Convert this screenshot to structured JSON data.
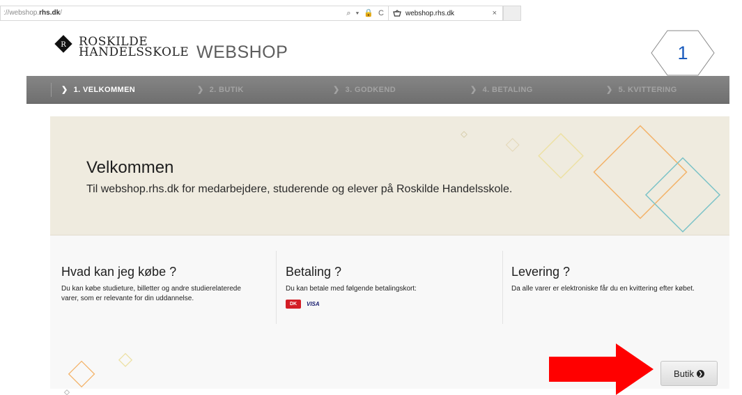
{
  "browser": {
    "url_prefix": "://webshop.",
    "url_domain": "rhs.dk",
    "url_suffix": "/",
    "tab_title": "webshop.rhs.dk",
    "tab_close": "×",
    "address_icons": "⌕ ▾ 🔒 C"
  },
  "header": {
    "logo_line1": "ROSKILDE",
    "logo_line2": "HANDELSSKOLE",
    "webshop": "WEBSHOP",
    "step_number": "1"
  },
  "steps": [
    {
      "label": "1.  VELKOMMEN",
      "active": true
    },
    {
      "label": "2.  BUTIK",
      "active": false
    },
    {
      "label": "3.  GODKEND",
      "active": false
    },
    {
      "label": "4.  BETALING",
      "active": false
    },
    {
      "label": "5.  KVITTERING",
      "active": false
    }
  ],
  "hero": {
    "title": "Velkommen",
    "text": "Til webshop.rhs.dk for medarbejdere, studerende og elever på Roskilde Handelsskole."
  },
  "columns": {
    "buy": {
      "title": "Hvad kan jeg købe ?",
      "text": "Du kan købe studieture, billetter og andre studierelaterede varer, som er relevante for din uddannelse."
    },
    "payment": {
      "title": "Betaling ?",
      "text": "Du kan betale med følgende betalingskort:",
      "card1": "DK",
      "card2": "VISA"
    },
    "delivery": {
      "title": "Levering ?",
      "text": "Da alle varer er elektroniske får du en kvittering efter købet."
    }
  },
  "actions": {
    "butik_label": "Butik",
    "butik_icon": "❯"
  },
  "colors": {
    "accent_blue": "#1a5bbd",
    "hero_bg": "#efebdf",
    "nav_bg": "#7a7a7a",
    "arrow_red": "#ff0000",
    "deco_orange": "#f3b36a",
    "deco_teal": "#7cc3c8",
    "deco_yellow": "#ede1a4"
  }
}
